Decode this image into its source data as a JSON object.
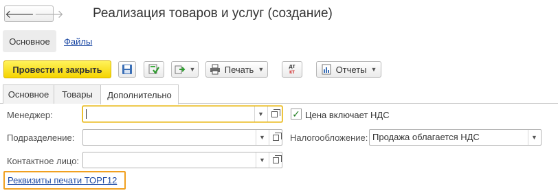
{
  "window": {
    "title": "Реализация товаров и услуг (создание)"
  },
  "nav": {
    "back_glyph": "🡐",
    "forward_glyph": "🡒"
  },
  "page_tabs": [
    {
      "label": "Основное"
    },
    {
      "label": "Файлы"
    }
  ],
  "toolbar": {
    "post_close_label": "Провести и закрыть",
    "print_label": "Печать",
    "reports_label": "Отчеты",
    "dt_kt_top": "дт",
    "dt_kt_bottom": "кт"
  },
  "form_tabs": [
    {
      "label": "Основное"
    },
    {
      "label": "Товары"
    },
    {
      "label": "Дополнительно"
    }
  ],
  "form": {
    "manager_label": "Менеджер:",
    "manager_value": "",
    "department_label": "Подразделение:",
    "department_value": "",
    "contact_label": "Контактное лицо:",
    "contact_value": "",
    "vat_included_label": "Цена включает НДС",
    "vat_included_checked": true,
    "taxation_label": "Налогообложение:",
    "taxation_value": "Продажа облагается НДС",
    "print_details_link": "Реквизиты печати ТОРГ12"
  },
  "colors": {
    "accent_yellow": "#f5d400",
    "link_blue": "#1a47a3",
    "highlight_orange": "#f0a020",
    "check_green": "#1f7d1f"
  }
}
